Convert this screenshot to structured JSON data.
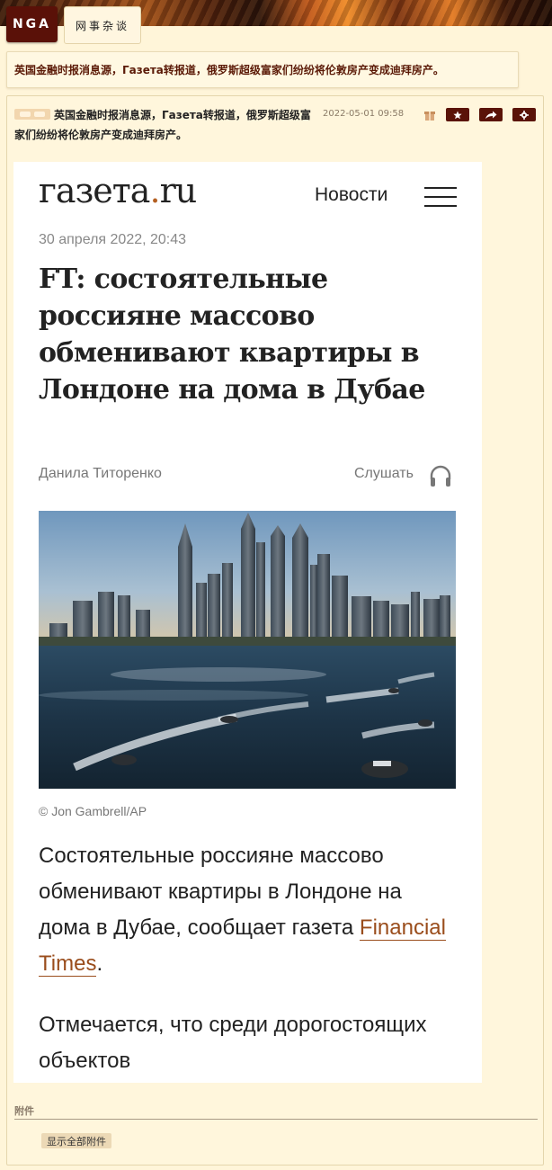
{
  "header": {
    "logo": "NGA",
    "forum_name": "网事杂谈"
  },
  "topic": {
    "title": "英国金融时报消息源，Газета转报道，俄罗斯超级富家们纷纷将伦敦房产变成迪拜房产。"
  },
  "post": {
    "text": "英国金融时报消息源，Газета转报道，俄罗斯超级富家们纷纷将伦敦房产变成迪拜房产。",
    "date": "2022-05-01 09:58",
    "icons": [
      "gift-icon",
      "star-icon",
      "share-icon",
      "gear-icon"
    ]
  },
  "article": {
    "logo_main": "газета",
    "logo_dot": ".",
    "logo_tld": "ru",
    "nav_label": "Новости",
    "date": "30 апреля 2022, 20:43",
    "headline": "FT: состоятельные россияне массово обменивают квартиры в Лондоне на дома в Дубае",
    "author": "Данила Титоренко",
    "listen_label": "Слушать",
    "photo_credit": "©  Jon Gambrell/AP",
    "lead_before": "Состоятельные россияне массово обменивают квартиры в Лондоне на дома в Дубае, сообщает газета ",
    "lead_link": "Financial Times",
    "lead_after": ".",
    "next_paragraph": "Отмечается, что среди дорогостоящих объектов"
  },
  "attachments": {
    "label": "附件",
    "show_all": "显示全部附件"
  },
  "colors": {
    "page_bg": "#fff5d9",
    "accent_dark": "#5a1308",
    "title_text": "#5b1a07",
    "link": "#9a4d1c"
  }
}
